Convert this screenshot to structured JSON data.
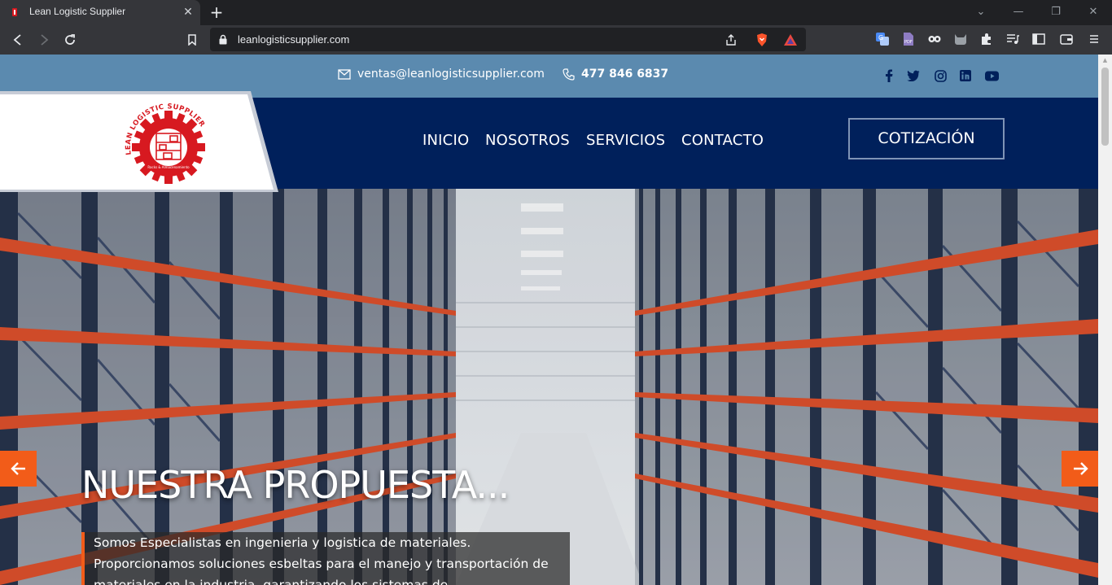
{
  "browser": {
    "tab_title": "Lean Logistic Supplier",
    "url": "leanlogisticsupplier.com"
  },
  "topbar": {
    "email": "ventas@leanlogisticsupplier.com",
    "phone": "477 846 6837",
    "socials": [
      "facebook-icon",
      "twitter-icon",
      "instagram-icon",
      "linkedin-icon",
      "youtube-icon"
    ]
  },
  "logo": {
    "ring_text": "LEAN LOGISTIC SUPPLIER",
    "tagline": "Racks & Almacenamiento"
  },
  "nav": {
    "items": [
      "INICIO",
      "NOSOTROS",
      "SERVICIOS",
      "CONTACTO"
    ],
    "cta": "COTIZACIÓN"
  },
  "hero": {
    "title": "NUESTRA PROPUESTA...",
    "text": "Somos Especialistas en ingenieria y logistica de materiales. Proporcionamos soluciones esbeltas para el manejo y transportación de materiales en la industria, garantizando los sistemas de"
  },
  "colors": {
    "topbar": "#5b8aaf",
    "header": "#00205b",
    "accent": "#f25c19",
    "logo_red": "#d71920"
  }
}
